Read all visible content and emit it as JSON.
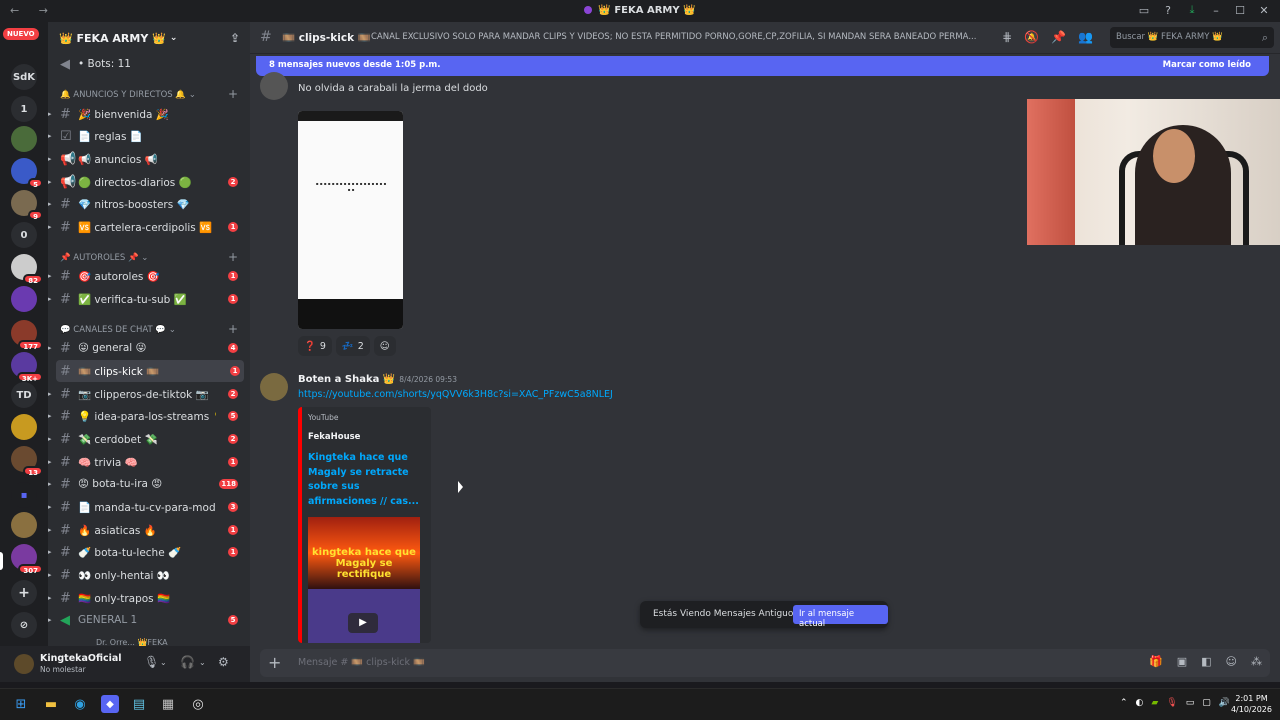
{
  "titlebar": {
    "title": "👑 FEKA ARMY 👑",
    "nav": "← →"
  },
  "guilds": {
    "nuevo": "NUEVO",
    "items": [
      {
        "label": "SdK",
        "badge": ""
      },
      {
        "label": "SdK",
        "badge": ""
      },
      {
        "label": "1",
        "badge": ""
      },
      {
        "label": "",
        "badge": ""
      },
      {
        "label": "",
        "badge": "5"
      },
      {
        "label": "",
        "badge": "9"
      },
      {
        "label": "0",
        "badge": ""
      },
      {
        "label": "",
        "badge": "82"
      },
      {
        "label": "",
        "badge": ""
      },
      {
        "label": "",
        "badge": "177"
      },
      {
        "label": "",
        "badge": "3K+"
      },
      {
        "label": "TD",
        "badge": ""
      },
      {
        "label": "",
        "badge": ""
      },
      {
        "label": "",
        "badge": "13"
      },
      {
        "label": "",
        "badge": ""
      },
      {
        "label": "",
        "badge": ""
      },
      {
        "label": "",
        "badge": "307"
      },
      {
        "label": "+",
        "badge": ""
      },
      {
        "label": "",
        "badge": ""
      }
    ]
  },
  "server": {
    "name": "👑 FEKA ARMY 👑",
    "bots_label": "• Bots: 11",
    "categories": [
      {
        "label": "🔔 ANUNCIOS Y DIRECTOS 🔔"
      },
      {
        "label": "📌 AUTOROLES 📌"
      },
      {
        "label": "💬 CANALES DE CHAT 💬"
      }
    ],
    "channels": [
      {
        "label": "🎉 bienvenida 🎉",
        "badge": ""
      },
      {
        "label": "📄 reglas 📄",
        "badge": ""
      },
      {
        "label": "📢 anuncios 📢",
        "badge": ""
      },
      {
        "label": "🟢 directos-diarios 🟢",
        "badge": "2"
      },
      {
        "label": "💎 nitros-boosters 💎",
        "badge": ""
      },
      {
        "label": "🆚 cartelera-cerdipolis 🆚",
        "badge": "1"
      },
      {
        "label": "🎯 autoroles 🎯",
        "badge": "1"
      },
      {
        "label": "✅ verifica-tu-sub ✅",
        "badge": "1"
      },
      {
        "label": "😜 general 😜",
        "badge": "4"
      },
      {
        "label": "🎞️ clips-kick 🎞️",
        "badge": "1"
      },
      {
        "label": "📷 clipperos-de-tiktok 📷",
        "badge": "2"
      },
      {
        "label": "💡 idea-para-los-streams 💡",
        "badge": "5"
      },
      {
        "label": "💸 cerdobet 💸",
        "badge": "2"
      },
      {
        "label": "🧠 trivia 🧠",
        "badge": "1"
      },
      {
        "label": "😡 bota-tu-ira 😡",
        "badge": "118"
      },
      {
        "label": "📄 manda-tu-cv-para-mod...",
        "badge": "3"
      },
      {
        "label": "🔥 asiaticas 🔥",
        "badge": "1"
      },
      {
        "label": "🍼 bota-tu-leche 🍼",
        "badge": "1"
      },
      {
        "label": "👀 only-hentai 👀",
        "badge": ""
      },
      {
        "label": "🏳️‍🌈 only-trapos 🏳️‍🌈",
        "badge": ""
      },
      {
        "label": "GENERAL 1",
        "badge": "5"
      },
      {
        "label": "Dr. Orre... 👑FEKA",
        "badge": ""
      }
    ]
  },
  "user": {
    "name": "KingtekaOficial",
    "status": "No molestar"
  },
  "channel_header": {
    "name": "🎞️ clips-kick 🎞️",
    "topic": "CANAL EXCLUSIVO SOLO PARA MANDAR CLIPS Y VIDEOS; NO ESTA PERMITIDO PORNO,GORE,CP,ZOFILIA, SI MANDAN SERA BANEADO PERMA...",
    "search_placeholder": "Buscar 👑 FEKA ARMY 👑"
  },
  "new_messages_bar": {
    "text": "8 mensajes nuevos desde 1:05 p.m.",
    "action": "Marcar como leído"
  },
  "messages": [
    {
      "text": "No olvida a carabali la jerma del dodo",
      "reactions": [
        {
          "emoji": "❓",
          "count": "9"
        },
        {
          "emoji": "💤",
          "count": "2"
        }
      ]
    },
    {
      "author": "Boten a Shaka 👑",
      "timestamp": "8/4/2026 09:53",
      "link": "https://youtube.com/shorts/yqQVV6k3H8c?si=XAC_PFzwC5a8NLEJ",
      "embed": {
        "provider": "YouTube",
        "author": "FekaHouse",
        "title": "Kingteka hace que Magaly se retracte sobre sus afirmaciones // cas...",
        "thumb_text": "kingteka hace que Magaly se rectifique"
      }
    }
  ],
  "old_messages_bar": {
    "text": "Estás Viendo Mensajes Antiguos",
    "button": "Ir al mensaje actual"
  },
  "composer": {
    "placeholder": "Mensaje # 🎞️ clips-kick 🎞️"
  },
  "taskbar": {
    "time": "2:01 PM",
    "date": "4/10/2026"
  }
}
